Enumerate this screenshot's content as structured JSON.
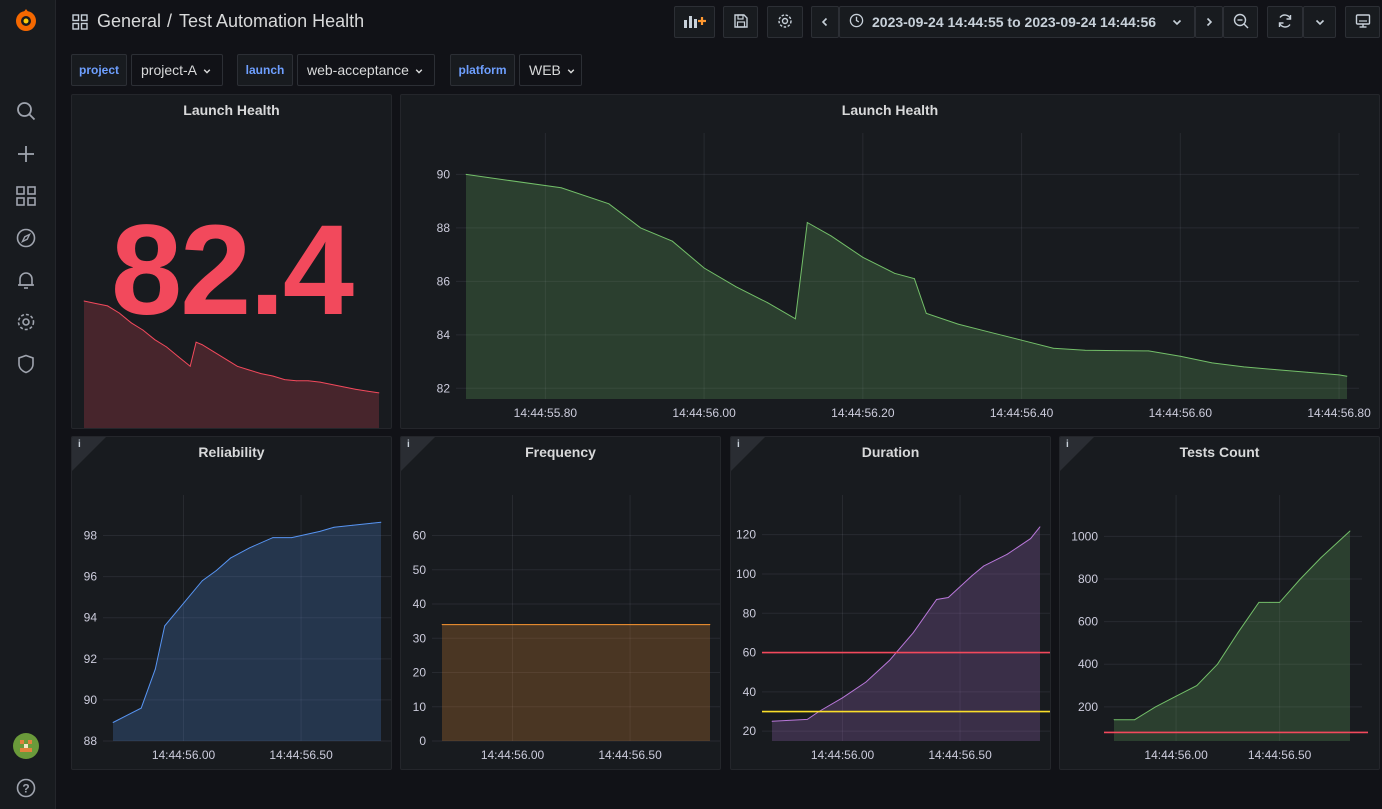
{
  "breadcrumb": {
    "folder": "General",
    "separator": "/",
    "dashboard": "Test Automation Health"
  },
  "time_range": {
    "label": "2023-09-24 14:44:55 to 2023-09-24 14:44:56"
  },
  "variables": [
    {
      "name": "project",
      "value": "project-A"
    },
    {
      "name": "launch",
      "value": "web-acceptance"
    },
    {
      "name": "platform",
      "value": "WEB"
    }
  ],
  "icons": {
    "sidebar": [
      "grafana-logo-icon",
      "search-icon",
      "plus-icon",
      "dashboards-icon",
      "explore-icon",
      "alert-bell-icon",
      "gear-icon",
      "shield-icon",
      "avatar",
      "help-icon"
    ],
    "toolbar": [
      "add-panel-icon",
      "save-icon",
      "gear-icon",
      "chevron-left-icon",
      "clock-icon",
      "chevron-down-icon",
      "chevron-right-icon",
      "zoom-out-icon",
      "refresh-icon",
      "chevron-down-icon",
      "tv-mode-icon"
    ]
  },
  "colors": {
    "red": "#f2495c",
    "green": "#73bf69",
    "blue": "#5794f2",
    "orange": "#ff9830",
    "purple": "#b877d9",
    "yellow": "#fade2a"
  },
  "panels": {
    "stat": {
      "title": "Launch Health",
      "value": "82.4"
    },
    "health": {
      "title": "Launch Health"
    },
    "reliability": {
      "title": "Reliability",
      "info": "i"
    },
    "frequency": {
      "title": "Frequency",
      "info": "i"
    },
    "duration": {
      "title": "Duration",
      "info": "i"
    },
    "tests_count": {
      "title": "Tests Count",
      "info": "i"
    }
  },
  "chart_data": [
    {
      "id": "stat-sparkline",
      "type": "area",
      "color": "#f2495c",
      "x": [
        0,
        0.04,
        0.08,
        0.12,
        0.16,
        0.2,
        0.24,
        0.28,
        0.32,
        0.34,
        0.36,
        0.38,
        0.4,
        0.44,
        0.48,
        0.52,
        0.56,
        0.6,
        0.64,
        0.68,
        0.72,
        0.76,
        0.8,
        0.84,
        0.88,
        0.92,
        0.96,
        1.0
      ],
      "values": [
        90,
        89.8,
        89.6,
        89.0,
        88.2,
        87.6,
        86.8,
        86.2,
        85.4,
        85.0,
        84.6,
        86.6,
        86.4,
        85.8,
        85.2,
        84.6,
        84.3,
        84.0,
        83.8,
        83.5,
        83.4,
        83.4,
        83.3,
        83.1,
        82.9,
        82.7,
        82.55,
        82.4
      ],
      "ylim": [
        79.5,
        90.5
      ]
    },
    {
      "id": "launch-health",
      "type": "area",
      "color": "#73bf69",
      "x": [
        55.7,
        55.82,
        55.88,
        55.92,
        55.96,
        56.0,
        56.04,
        56.08,
        56.115,
        56.13,
        56.16,
        56.2,
        56.24,
        56.265,
        56.28,
        56.32,
        56.36,
        56.4,
        56.44,
        56.48,
        56.52,
        56.56,
        56.6,
        56.64,
        56.68,
        56.72,
        56.76,
        56.8,
        56.81
      ],
      "values": [
        90.0,
        89.5,
        88.9,
        88.0,
        87.5,
        86.5,
        85.8,
        85.2,
        84.6,
        88.2,
        87.7,
        86.9,
        86.3,
        86.1,
        84.8,
        84.4,
        84.1,
        83.8,
        83.5,
        83.42,
        83.41,
        83.4,
        83.2,
        82.95,
        82.8,
        82.7,
        82.6,
        82.5,
        82.45
      ],
      "xticks": [
        "14:44:55.80",
        "14:44:56.00",
        "14:44:56.20",
        "14:44:56.40",
        "14:44:56.60",
        "14:44:56.80"
      ],
      "xtick_values": [
        55.8,
        56.0,
        56.2,
        56.4,
        56.6,
        56.8
      ],
      "yticks": [
        82,
        84,
        86,
        88,
        90
      ],
      "xlim": [
        55.7,
        56.81
      ],
      "ylim": [
        81.6,
        90.8
      ],
      "grid": true
    },
    {
      "id": "reliability",
      "type": "area",
      "color": "#5794f2",
      "x": [
        55.7,
        55.82,
        55.88,
        55.92,
        56.0,
        56.08,
        56.14,
        56.2,
        56.28,
        56.38,
        56.46,
        56.58,
        56.64,
        56.72,
        56.8,
        56.84
      ],
      "values": [
        88.9,
        89.6,
        91.5,
        93.6,
        94.7,
        95.8,
        96.3,
        96.9,
        97.4,
        97.9,
        97.9,
        98.2,
        98.4,
        98.5,
        98.6,
        98.65
      ],
      "xticks": [
        "14:44:56.00",
        "14:44:56.50"
      ],
      "xtick_values": [
        56.0,
        56.5
      ],
      "yticks": [
        88,
        90,
        92,
        94,
        96,
        98
      ],
      "xlim": [
        55.7,
        56.84
      ],
      "ylim": [
        88.0,
        99.0
      ],
      "grid": true
    },
    {
      "id": "frequency",
      "type": "area",
      "color": "#ff9830",
      "x": [
        55.7,
        56.84
      ],
      "values": [
        34,
        34
      ],
      "xticks": [
        "14:44:56.00",
        "14:44:56.50"
      ],
      "xtick_values": [
        56.0,
        56.5
      ],
      "yticks": [
        0,
        10,
        20,
        30,
        40,
        50,
        60
      ],
      "xlim": [
        55.7,
        56.84
      ],
      "ylim": [
        0,
        66
      ],
      "grid": true
    },
    {
      "id": "duration",
      "type": "area",
      "color": "#b877d9",
      "x": [
        55.7,
        55.85,
        55.9,
        56.0,
        56.1,
        56.2,
        56.3,
        56.4,
        56.45,
        56.55,
        56.6,
        56.7,
        56.8,
        56.84
      ],
      "values": [
        25,
        26,
        30,
        37,
        45,
        56,
        70,
        87,
        88,
        99,
        104,
        110,
        118,
        124
      ],
      "thresholds": [
        {
          "value": 60,
          "color": "#f2495c"
        },
        {
          "value": 30,
          "color": "#fade2a"
        }
      ],
      "xticks": [
        "14:44:56.00",
        "14:44:56.50"
      ],
      "xtick_values": [
        56.0,
        56.5
      ],
      "yticks": [
        20,
        40,
        60,
        80,
        100,
        120
      ],
      "xlim": [
        55.7,
        56.84
      ],
      "ylim": [
        15,
        130
      ],
      "grid": true
    },
    {
      "id": "tests-count",
      "type": "area",
      "color": "#73bf69",
      "x": [
        55.7,
        55.8,
        55.9,
        56.0,
        56.1,
        56.2,
        56.3,
        56.4,
        56.45,
        56.5,
        56.6,
        56.7,
        56.84
      ],
      "values": [
        140,
        140,
        200,
        250,
        300,
        400,
        550,
        690,
        690,
        690,
        800,
        900,
        1025
      ],
      "thresholds": [
        {
          "value": 80,
          "color": "#f2495c"
        }
      ],
      "xticks": [
        "14:44:56.00",
        "14:44:56.50"
      ],
      "xtick_values": [
        56.0,
        56.5
      ],
      "yticks": [
        200,
        400,
        600,
        800,
        1000
      ],
      "xlim": [
        55.7,
        56.84
      ],
      "ylim": [
        40,
        1100
      ],
      "grid": true
    }
  ]
}
